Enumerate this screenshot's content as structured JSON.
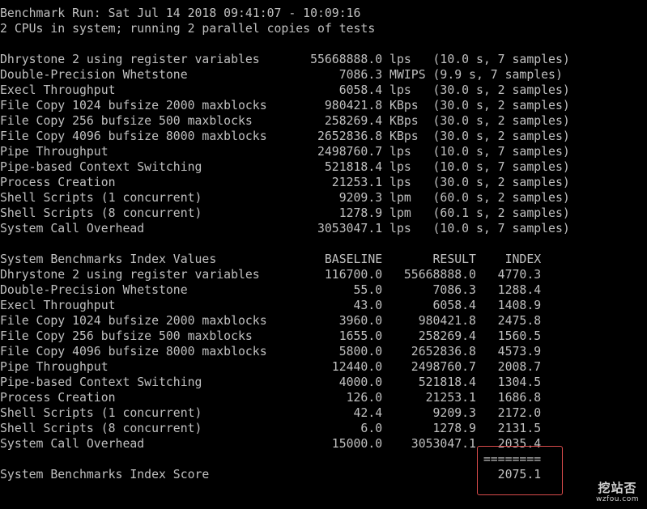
{
  "colors": {
    "background": "#000000",
    "text": "#c0c0c0",
    "highlight_border": "#d94b4b"
  },
  "terminal": {
    "lines": [
      "Benchmark Run: Sat Jul 14 2018 09:41:07 - 10:09:16",
      "2 CPUs in system; running 2 parallel copies of tests",
      "",
      "Dhrystone 2 using register variables       55668888.0 lps   (10.0 s, 7 samples)",
      "Double-Precision Whetstone                     7086.3 MWIPS (9.9 s, 7 samples)",
      "Execl Throughput                               6058.4 lps   (30.0 s, 2 samples)",
      "File Copy 1024 bufsize 2000 maxblocks        980421.8 KBps  (30.0 s, 2 samples)",
      "File Copy 256 bufsize 500 maxblocks          258269.4 KBps  (30.0 s, 2 samples)",
      "File Copy 4096 bufsize 8000 maxblocks       2652836.8 KBps  (30.0 s, 2 samples)",
      "Pipe Throughput                             2498760.7 lps   (10.0 s, 7 samples)",
      "Pipe-based Context Switching                 521818.4 lps   (10.0 s, 7 samples)",
      "Process Creation                              21253.1 lps   (30.0 s, 2 samples)",
      "Shell Scripts (1 concurrent)                   9209.3 lpm   (60.0 s, 2 samples)",
      "Shell Scripts (8 concurrent)                   1278.9 lpm   (60.1 s, 2 samples)",
      "System Call Overhead                        3053047.1 lps   (10.0 s, 7 samples)",
      "",
      "System Benchmarks Index Values               BASELINE       RESULT    INDEX",
      "Dhrystone 2 using register variables         116700.0   55668888.0   4770.3",
      "Double-Precision Whetstone                       55.0       7086.3   1288.4",
      "Execl Throughput                                 43.0       6058.4   1408.9",
      "File Copy 1024 bufsize 2000 maxblocks          3960.0     980421.8   2475.8",
      "File Copy 256 bufsize 500 maxblocks            1655.0     258269.4   1560.5",
      "File Copy 4096 bufsize 8000 maxblocks          5800.0    2652836.8   4573.9",
      "Pipe Throughput                               12440.0    2498760.7   2008.7",
      "Pipe-based Context Switching                   4000.0     521818.4   1304.5",
      "Process Creation                                126.0      21253.1   1686.8",
      "Shell Scripts (1 concurrent)                     42.4       9209.3   2172.0",
      "Shell Scripts (8 concurrent)                      6.0       1278.9   2131.5",
      "System Call Overhead                          15000.0    3053047.1   2035.4",
      "                                                                   ========",
      "System Benchmarks Index Score                                        2075.1"
    ]
  },
  "watermark": {
    "title": "挖站否",
    "url": "wzfou.com"
  }
}
